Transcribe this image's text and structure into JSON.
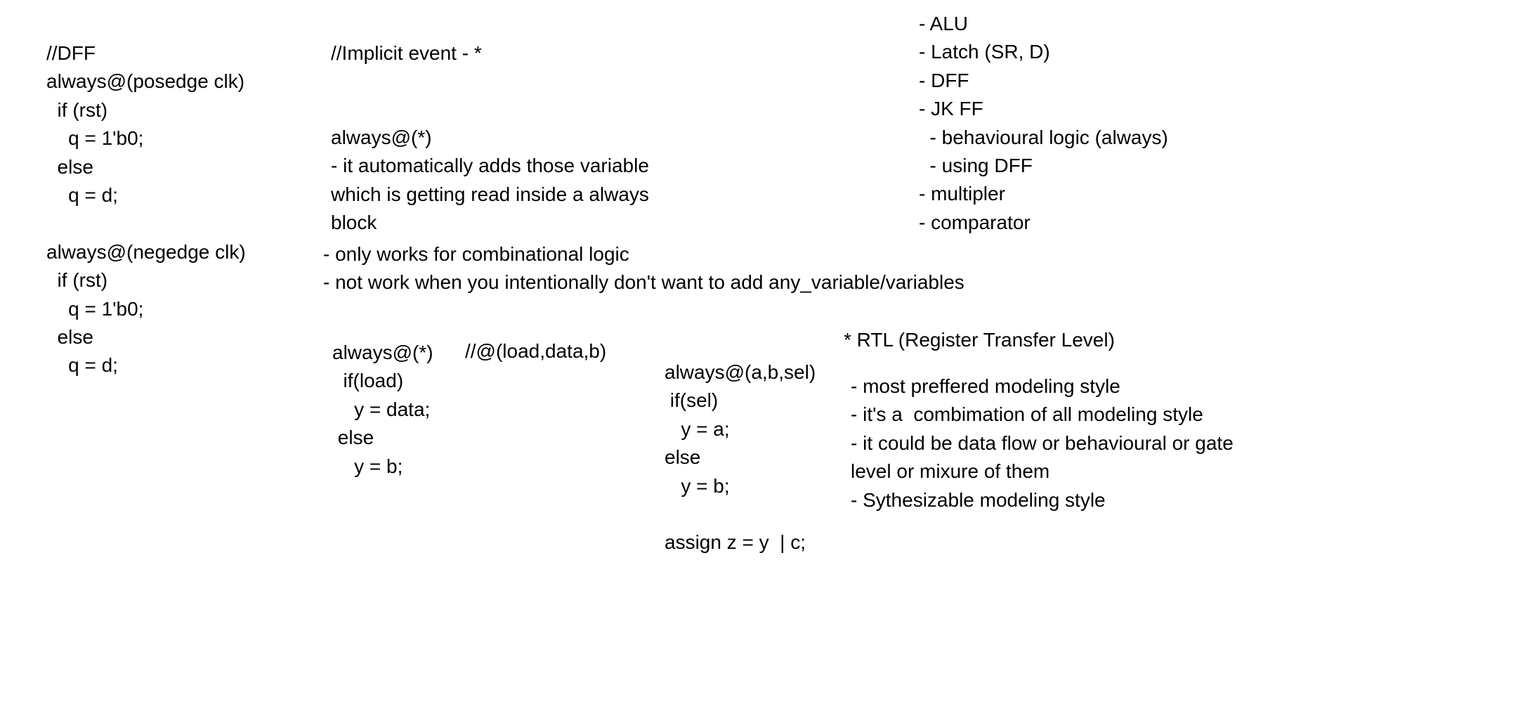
{
  "dff_notes": {
    "lines": [
      "//DFF",
      "always@(posedge clk)",
      "  if (rst)",
      "    q = 1'b0;",
      "  else",
      "    q = d;",
      "",
      "always@(negedge clk)",
      "  if (rst)",
      "    q = 1'b0;",
      "  else",
      "    q = d;"
    ]
  },
  "implicit_event": {
    "title": "//Implicit event - *",
    "lines": [
      "always@(*)",
      "- it automatically adds those variable",
      "which is getting read inside a always",
      "block"
    ]
  },
  "combinational_notes": {
    "lines": [
      "- only works for combinational logic",
      "- not work when you intentionally don't want to add any_variable/variables"
    ]
  },
  "topic_list": {
    "lines": [
      "- ALU",
      "- Latch (SR, D)",
      "- DFF",
      "- JK FF",
      "  - behavioural logic (always)",
      "  - using DFF",
      "- multipler",
      "- comparator"
    ]
  },
  "example_star": {
    "lines": [
      "always@(*)",
      "  if(load)",
      "    y = data;",
      " else",
      "    y = b;"
    ],
    "comment": "//@(load,data,b)"
  },
  "example_sel": {
    "lines": [
      "always@(a,b,sel)",
      " if(sel)",
      "   y = a;",
      "else",
      "   y = b;",
      "",
      "assign z = y  | c;"
    ]
  },
  "rtl": {
    "title": "* RTL (Register Transfer Level)",
    "lines": [
      "- most preffered modeling style",
      "- it's a  combimation of all modeling style",
      "- it could be data flow or behavioural or gate",
      "level or mixure of them",
      "- Sythesizable modeling style"
    ]
  }
}
